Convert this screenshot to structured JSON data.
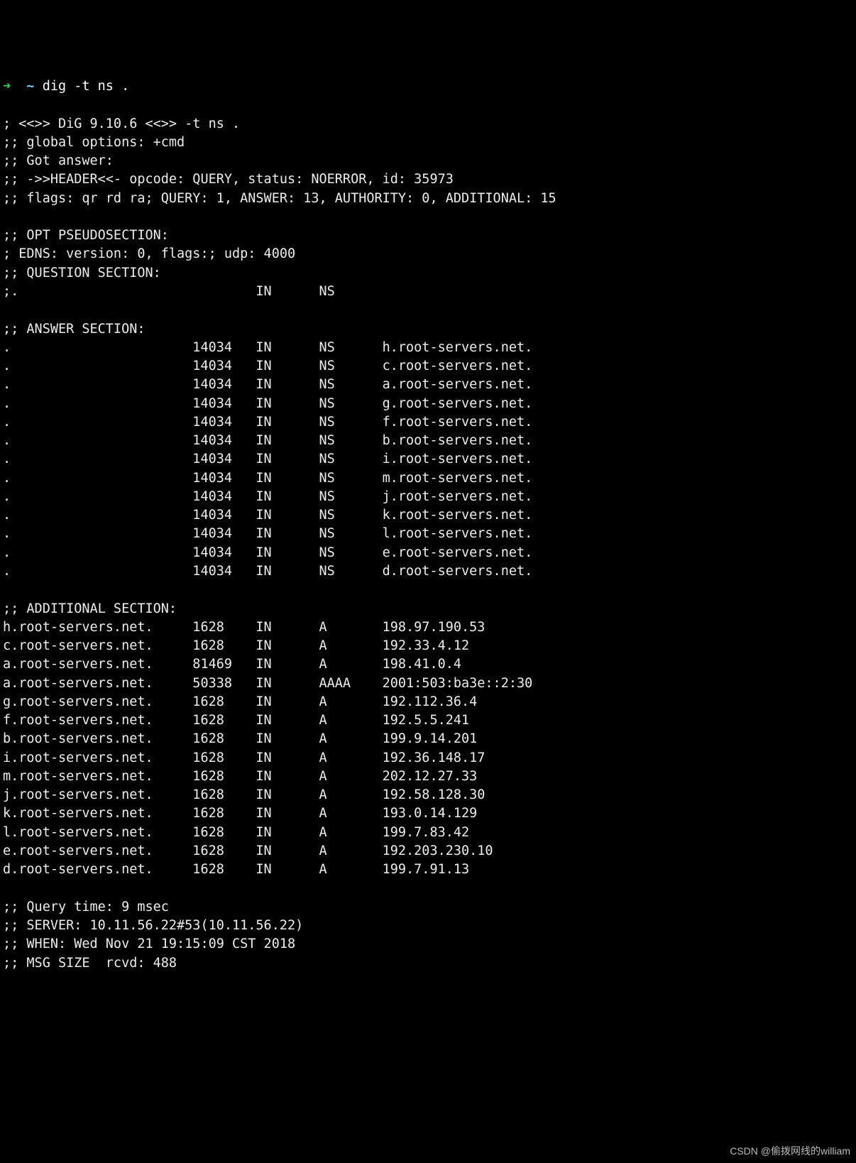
{
  "prompt": {
    "arrow": "➜",
    "cwd": "~",
    "command": "dig -t ns ."
  },
  "header": {
    "banner": "; <<>> DiG 9.10.6 <<>> -t ns .",
    "global_options": ";; global options: +cmd",
    "got_answer": ";; Got answer:",
    "header_line": ";; ->>HEADER<<- opcode: QUERY, status: NOERROR, id: 35973",
    "flags_line": ";; flags: qr rd ra; QUERY: 1, ANSWER: 13, AUTHORITY: 0, ADDITIONAL: 15"
  },
  "opt_pseudosection": {
    "label": ";; OPT PSEUDOSECTION:",
    "edns": "; EDNS: version: 0, flags:; udp: 4000"
  },
  "question_section": {
    "label": ";; QUESTION SECTION:",
    "row": {
      "name": ";.",
      "class": "IN",
      "type": "NS"
    }
  },
  "answer_section": {
    "label": ";; ANSWER SECTION:",
    "rows": [
      {
        "name": ".",
        "ttl": "14034",
        "class": "IN",
        "type": "NS",
        "data": "h.root-servers.net."
      },
      {
        "name": ".",
        "ttl": "14034",
        "class": "IN",
        "type": "NS",
        "data": "c.root-servers.net."
      },
      {
        "name": ".",
        "ttl": "14034",
        "class": "IN",
        "type": "NS",
        "data": "a.root-servers.net."
      },
      {
        "name": ".",
        "ttl": "14034",
        "class": "IN",
        "type": "NS",
        "data": "g.root-servers.net."
      },
      {
        "name": ".",
        "ttl": "14034",
        "class": "IN",
        "type": "NS",
        "data": "f.root-servers.net."
      },
      {
        "name": ".",
        "ttl": "14034",
        "class": "IN",
        "type": "NS",
        "data": "b.root-servers.net."
      },
      {
        "name": ".",
        "ttl": "14034",
        "class": "IN",
        "type": "NS",
        "data": "i.root-servers.net."
      },
      {
        "name": ".",
        "ttl": "14034",
        "class": "IN",
        "type": "NS",
        "data": "m.root-servers.net."
      },
      {
        "name": ".",
        "ttl": "14034",
        "class": "IN",
        "type": "NS",
        "data": "j.root-servers.net."
      },
      {
        "name": ".",
        "ttl": "14034",
        "class": "IN",
        "type": "NS",
        "data": "k.root-servers.net."
      },
      {
        "name": ".",
        "ttl": "14034",
        "class": "IN",
        "type": "NS",
        "data": "l.root-servers.net."
      },
      {
        "name": ".",
        "ttl": "14034",
        "class": "IN",
        "type": "NS",
        "data": "e.root-servers.net."
      },
      {
        "name": ".",
        "ttl": "14034",
        "class": "IN",
        "type": "NS",
        "data": "d.root-servers.net."
      }
    ]
  },
  "additional_section": {
    "label": ";; ADDITIONAL SECTION:",
    "rows": [
      {
        "name": "h.root-servers.net.",
        "ttl": "1628",
        "class": "IN",
        "type": "A",
        "data": "198.97.190.53"
      },
      {
        "name": "c.root-servers.net.",
        "ttl": "1628",
        "class": "IN",
        "type": "A",
        "data": "192.33.4.12"
      },
      {
        "name": "a.root-servers.net.",
        "ttl": "81469",
        "class": "IN",
        "type": "A",
        "data": "198.41.0.4"
      },
      {
        "name": "a.root-servers.net.",
        "ttl": "50338",
        "class": "IN",
        "type": "AAAA",
        "data": "2001:503:ba3e::2:30"
      },
      {
        "name": "g.root-servers.net.",
        "ttl": "1628",
        "class": "IN",
        "type": "A",
        "data": "192.112.36.4"
      },
      {
        "name": "f.root-servers.net.",
        "ttl": "1628",
        "class": "IN",
        "type": "A",
        "data": "192.5.5.241"
      },
      {
        "name": "b.root-servers.net.",
        "ttl": "1628",
        "class": "IN",
        "type": "A",
        "data": "199.9.14.201"
      },
      {
        "name": "i.root-servers.net.",
        "ttl": "1628",
        "class": "IN",
        "type": "A",
        "data": "192.36.148.17"
      },
      {
        "name": "m.root-servers.net.",
        "ttl": "1628",
        "class": "IN",
        "type": "A",
        "data": "202.12.27.33"
      },
      {
        "name": "j.root-servers.net.",
        "ttl": "1628",
        "class": "IN",
        "type": "A",
        "data": "192.58.128.30"
      },
      {
        "name": "k.root-servers.net.",
        "ttl": "1628",
        "class": "IN",
        "type": "A",
        "data": "193.0.14.129"
      },
      {
        "name": "l.root-servers.net.",
        "ttl": "1628",
        "class": "IN",
        "type": "A",
        "data": "199.7.83.42"
      },
      {
        "name": "e.root-servers.net.",
        "ttl": "1628",
        "class": "IN",
        "type": "A",
        "data": "192.203.230.10"
      },
      {
        "name": "d.root-servers.net.",
        "ttl": "1628",
        "class": "IN",
        "type": "A",
        "data": "199.7.91.13"
      }
    ]
  },
  "footer": {
    "query_time": ";; Query time: 9 msec",
    "server": ";; SERVER: 10.11.56.22#53(10.11.56.22)",
    "when": ";; WHEN: Wed Nov 21 19:15:09 CST 2018",
    "msg_size": ";; MSG SIZE  rcvd: 488"
  },
  "watermark": "CSDN @偷拨网线的william",
  "columns": {
    "name": 24,
    "ttl": 8,
    "class": 8,
    "type": 8
  }
}
